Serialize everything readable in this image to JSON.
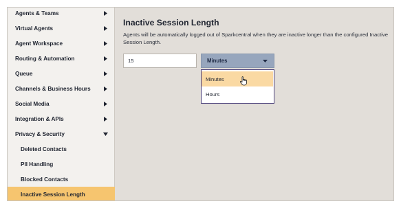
{
  "sidebar": {
    "items": [
      {
        "label": "Agents & Teams",
        "indicator": "chevron-right-icon"
      },
      {
        "label": "Virtual Agents",
        "indicator": "chevron-right-icon"
      },
      {
        "label": "Agent Workspace",
        "indicator": "chevron-right-icon"
      },
      {
        "label": "Routing & Automation",
        "indicator": "chevron-right-icon"
      },
      {
        "label": "Queue",
        "indicator": "chevron-right-icon"
      },
      {
        "label": "Channels & Business Hours",
        "indicator": "chevron-right-icon"
      },
      {
        "label": "Social Media",
        "indicator": "chevron-right-icon"
      },
      {
        "label": "Integration & APIs",
        "indicator": "chevron-right-icon"
      },
      {
        "label": "Privacy & Security",
        "indicator": "chevron-down-icon",
        "expanded": true
      }
    ],
    "subitems": [
      {
        "label": "Deleted Contacts"
      },
      {
        "label": "PII Handling"
      },
      {
        "label": "Blocked Contacts"
      },
      {
        "label": "Inactive Session Length",
        "active": true
      }
    ]
  },
  "main": {
    "title": "Inactive Session Length",
    "description": "Agents will be automatically logged out of Sparkcentral when they are inactive longer than the configured Inactive Session Length.",
    "length_input": {
      "value": "15"
    },
    "unit_select": {
      "selected": "Minutes",
      "open": true,
      "options": [
        {
          "label": "Minutes",
          "hovered": true
        },
        {
          "label": "Hours",
          "hovered": false
        }
      ]
    }
  },
  "colors": {
    "sidebar_bg": "#f3f1ee",
    "active_item": "#f6c56f",
    "content_bg": "#e2ded9",
    "select_bg": "#97a6bd",
    "option_hover": "#fad9a3",
    "dropdown_border": "#4a3f7a"
  }
}
